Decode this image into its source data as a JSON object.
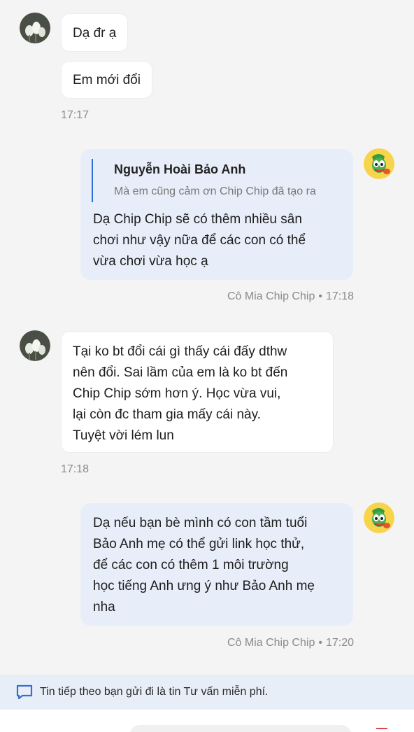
{
  "messages": {
    "m1": {
      "text": "Dạ đr ạ"
    },
    "m2": {
      "text": "Em mới đổi"
    },
    "m2_time": "17:17",
    "m3": {
      "quote_author": "Nguyễn Hoài Bảo Anh",
      "quote_text": "Mà em cũng cảm ơn Chip Chip đã tạo ra",
      "lines": [
        "Dạ Chip Chip sẽ có thêm nhiều sân",
        "chơi như vậy nữa để các con có thể",
        "vừa chơi vừa học ạ"
      ],
      "sender": "Cô Mia Chip Chip",
      "sep": "•",
      "time": "17:18"
    },
    "m4": {
      "lines": [
        "Tại ko bt đổi cái gì thấy cái đấy dthw",
        "nên đổi. Sai lầm của em là ko bt đến",
        "Chip Chip sớm hơn ý. Học vừa vui,",
        "lại còn đc tham gia mấy cái này.",
        "Tuyệt vời lém lun"
      ],
      "time": "17:18"
    },
    "m5": {
      "lines": [
        "Dạ nếu bạn bè mình có con tầm tuổi",
        "Bảo Anh mẹ có thể gửi link học thử,",
        "để các con có thêm 1 môi trường",
        "học tiếng Anh ưng ý như Bảo Anh mẹ",
        "nha"
      ],
      "sender": "Cô Mia Chip Chip",
      "sep": "•",
      "time": "17:20"
    }
  },
  "notice": {
    "text": "Tin tiếp theo bạn gửi đi là tin Tư vấn miễn phí.",
    "icon": "chat-bubble-icon"
  },
  "colors": {
    "accent": "#2f6fd6",
    "outgoing_bubble": "#e8eef9",
    "notice_bg": "#e8eef8"
  }
}
